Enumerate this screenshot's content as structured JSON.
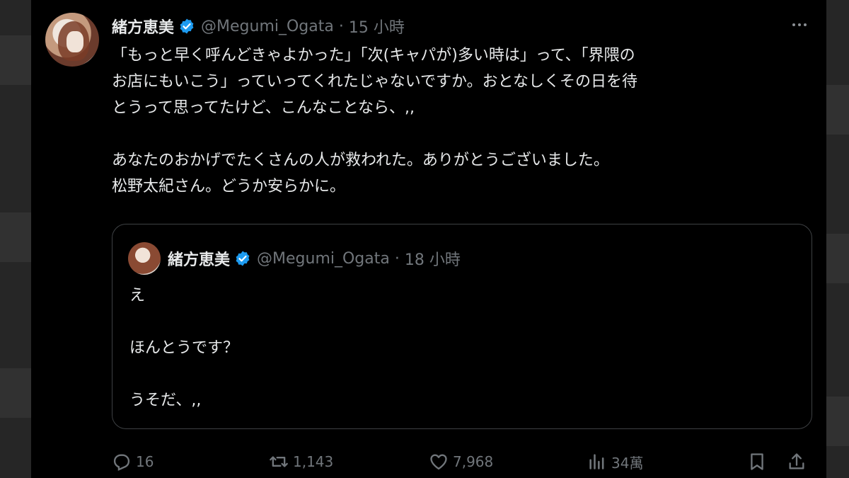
{
  "tweet": {
    "author_name": "緒方恵美",
    "author_handle": "@Megumi_Ogata",
    "timestamp": "15 小時",
    "lines": [
      "「もっと早く呼んどきゃよかった」「次(キャパが)多い時は」って、「界隈の",
      "お店にもいこう」っていってくれたじゃないですか。おとなしくその日を待",
      "とうって思ってたけど、こんなことなら、,,",
      "",
      "あなたのおかげでたくさんの人が救われた。ありがとうございました。",
      "松野太紀さん。どうか安らかに。"
    ]
  },
  "quote": {
    "author_name": "緒方恵美",
    "author_handle": "@Megumi_Ogata",
    "timestamp": "18 小時",
    "lines": [
      "え",
      "",
      "ほんとうです？",
      "",
      "うそだ、,,"
    ]
  },
  "actions": {
    "replies": "16",
    "reposts": "1,143",
    "likes": "7,968",
    "views": "34萬"
  },
  "colors": {
    "background": "#000000",
    "text": "#e7e9ea",
    "muted": "#71767b",
    "verified": "#1d9bf0",
    "border": "#3e4144"
  },
  "icons": [
    "verified-badge-icon",
    "more-icon",
    "reply-icon",
    "repost-icon",
    "like-icon",
    "views-icon",
    "bookmark-icon",
    "share-icon"
  ]
}
